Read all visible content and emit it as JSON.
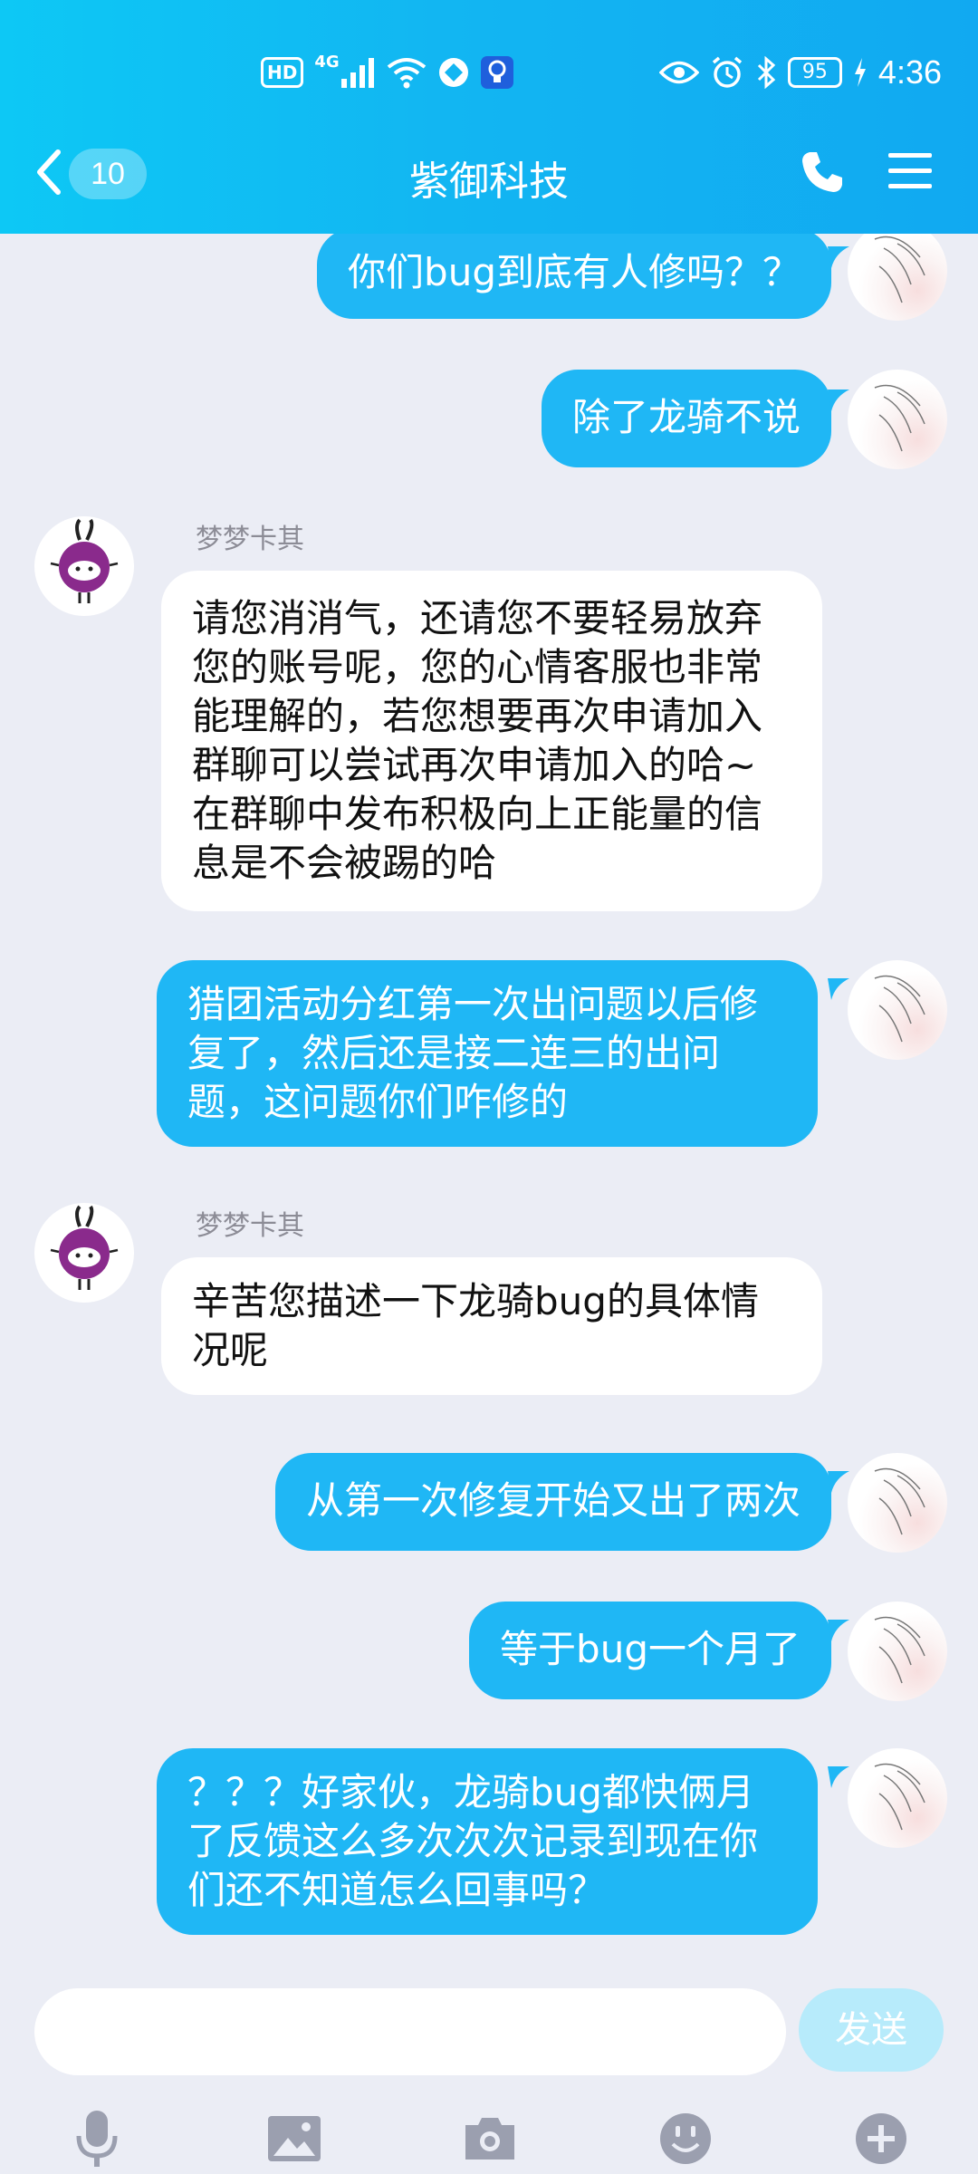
{
  "status_bar": {
    "hd_label": "HD",
    "network_label": "4G",
    "battery_level": "95",
    "time": "4:36"
  },
  "nav": {
    "unread_count": "10",
    "title": "紫御科技"
  },
  "messages": [
    {
      "sender": "self",
      "text": "你们bug到底有人修吗？？"
    },
    {
      "sender": "self",
      "text": "除了龙骑不说"
    },
    {
      "sender": "other",
      "name": "梦梦卡其",
      "text": "请您消消气，还请您不要轻易放弃您的账号呢，您的心情客服也非常能理解的，若您想要再次申请加入群聊可以尝试再次申请加入的哈~在群聊中发布积极向上正能量的信息是不会被踢的哈"
    },
    {
      "sender": "self",
      "text": "猎团活动分红第一次出问题以后修复了，然后还是接二连三的出问题，这问题你们咋修的"
    },
    {
      "sender": "other",
      "name": "梦梦卡其",
      "text": "辛苦您描述一下龙骑bug的具体情况呢"
    },
    {
      "sender": "self",
      "text": "从第一次修复开始又出了两次"
    },
    {
      "sender": "self",
      "text": "等于bug一个月了"
    },
    {
      "sender": "self",
      "text": "？？？好家伙，龙骑bug都快俩月了反馈这么多次次次记录到现在你们还不知道怎么回事吗？"
    }
  ],
  "input": {
    "placeholder": "",
    "send_label": "发送"
  },
  "toolbar": [
    "microphone-icon",
    "image-icon",
    "camera-icon",
    "emoji-icon",
    "plus-icon"
  ],
  "colors": {
    "header_start": "#0dc8f5",
    "header_end": "#11a9f1",
    "bubble_blue": "#1fb7f5",
    "bubble_white": "#ffffff",
    "background": "#ebedf5",
    "send_button": "#b7ebfb"
  }
}
